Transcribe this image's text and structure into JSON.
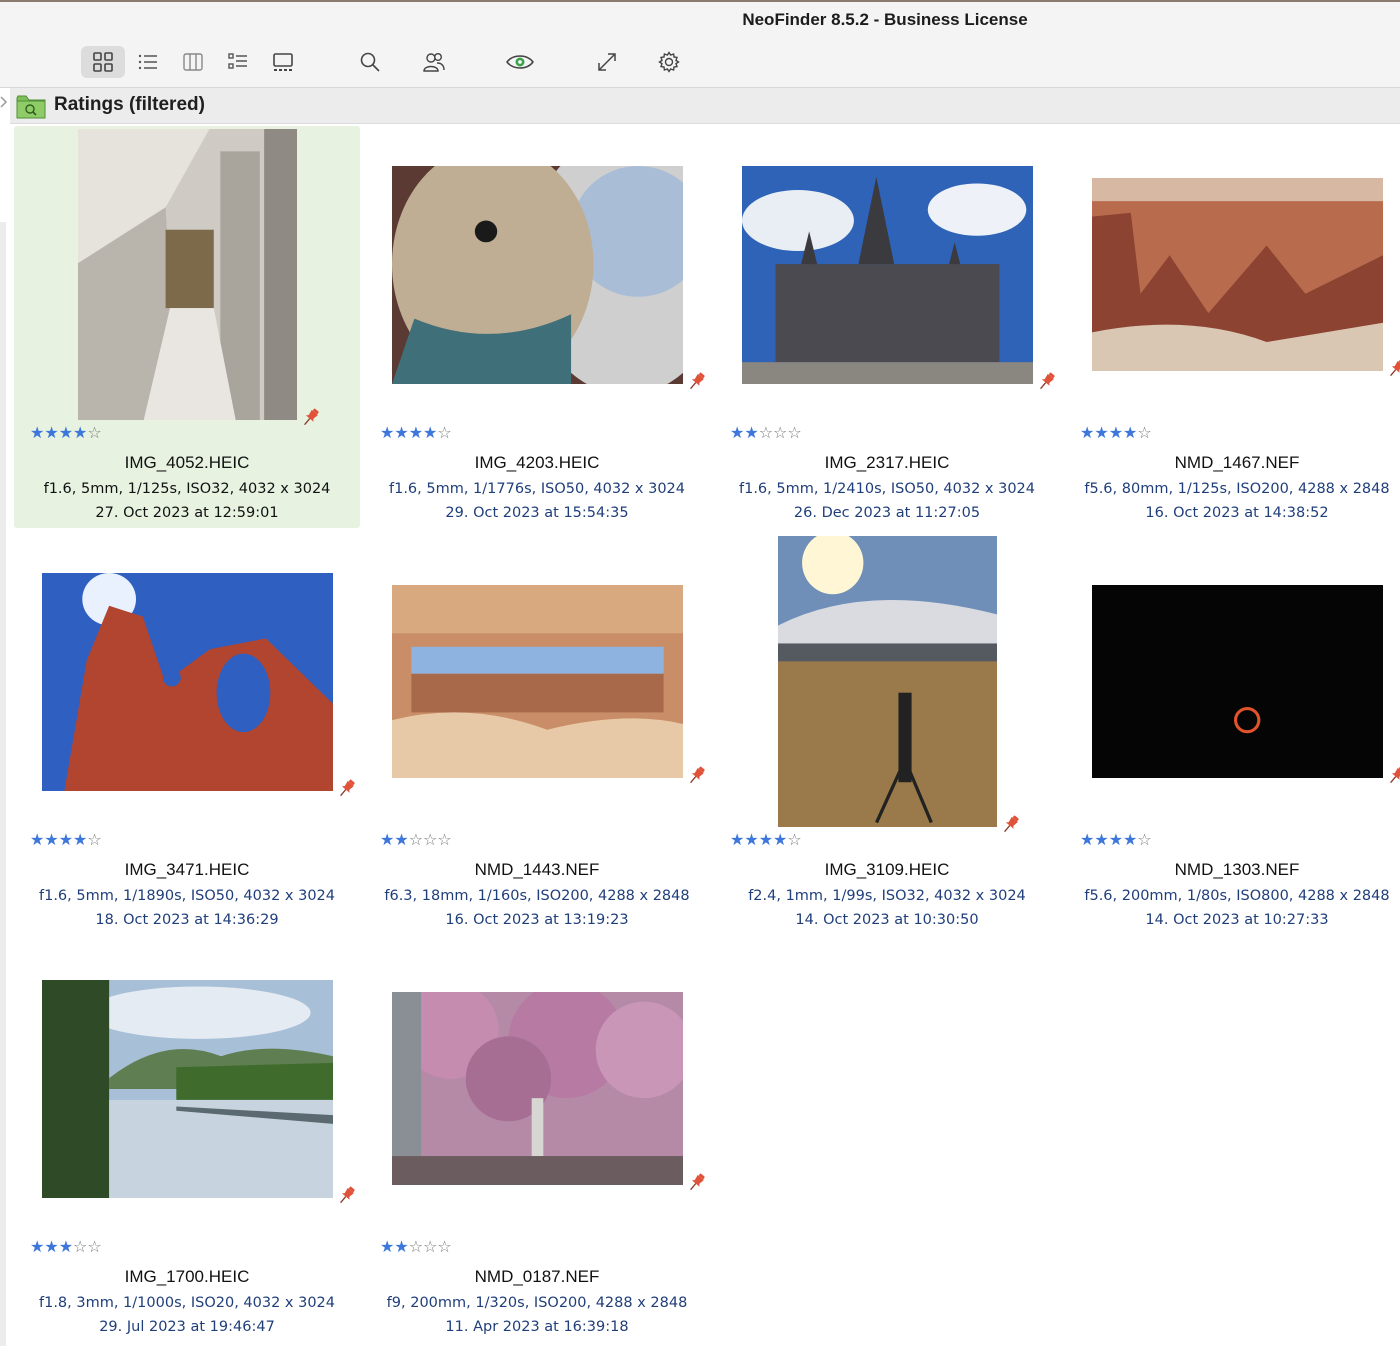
{
  "window": {
    "title": "NeoFinder 8.5.2 - Business License"
  },
  "toolbar": {
    "buttons": [
      {
        "name": "grid-view-icon",
        "active": true
      },
      {
        "name": "list-view-icon"
      },
      {
        "name": "column-view-icon"
      },
      {
        "name": "outline-view-icon"
      },
      {
        "name": "gallery-view-icon"
      },
      {
        "name": "search-icon"
      },
      {
        "name": "people-icon"
      },
      {
        "name": "eye-icon"
      },
      {
        "name": "fullscreen-icon"
      },
      {
        "name": "gear-icon"
      }
    ]
  },
  "path": {
    "label": "Ratings  (filtered)"
  },
  "items": [
    {
      "file": "IMG_4052.HEIC",
      "exif": "f1.6, 5mm, 1/125s, ISO32, 4032 x 3024",
      "date": "27. Oct 2023 at 12:59:01",
      "stars": 4,
      "selected": true,
      "pic": "interior",
      "orient": "portrait"
    },
    {
      "file": "IMG_4203.HEIC",
      "exif": "f1.6, 5mm, 1/1776s, ISO50, 4032 x 3024",
      "date": "29. Oct 2023 at 15:54:35",
      "stars": 4,
      "pic": "plush",
      "orient": "landscape43"
    },
    {
      "file": "IMG_2317.HEIC",
      "exif": "f1.6, 5mm, 1/2410s, ISO50, 4032 x 3024",
      "date": "26. Dec 2023 at 11:27:05",
      "stars": 2,
      "pic": "church",
      "orient": "landscape43"
    },
    {
      "file": "NMD_1467.NEF",
      "exif": "f5.6, 80mm, 1/125s, ISO200, 4288 x 2848",
      "date": "16. Oct 2023 at 14:38:52",
      "stars": 4,
      "pic": "canyon",
      "orient": "landscape32"
    },
    {
      "file": "IMG_3471.HEIC",
      "exif": "f1.6, 5mm, 1/1890s, ISO50, 4032 x 3024",
      "date": "18. Oct 2023 at 14:36:29",
      "stars": 4,
      "pic": "arch",
      "orient": "landscape43"
    },
    {
      "file": "NMD_1443.NEF",
      "exif": "f6.3, 18mm, 1/160s, ISO200, 4288 x 2848",
      "date": "16. Oct 2023 at 13:19:23",
      "stars": 2,
      "pic": "mesa",
      "orient": "landscape32"
    },
    {
      "file": "IMG_3109.HEIC",
      "exif": "f2.4, 1mm, 1/99s, ISO32, 4032 x 3024",
      "date": "14. Oct 2023 at 10:30:50",
      "stars": 4,
      "pic": "field",
      "orient": "portrait"
    },
    {
      "file": "NMD_1303.NEF",
      "exif": "f5.6, 200mm, 1/80s, ISO800, 4288 x 2848",
      "date": "14. Oct 2023 at 10:27:33",
      "stars": 4,
      "pic": "eclipse",
      "orient": "landscape32"
    },
    {
      "file": "IMG_1700.HEIC",
      "exif": "f1.8, 3mm, 1/1000s, ISO20, 4032 x 3024",
      "date": "29. Jul 2023 at 19:46:47",
      "stars": 3,
      "pic": "river",
      "orient": "landscape43"
    },
    {
      "file": "NMD_0187.NEF",
      "exif": "f9, 200mm, 1/320s, ISO200, 4288 x 2848",
      "date": "11. Apr 2023 at 16:39:18",
      "stars": 2,
      "pic": "blossom",
      "orient": "landscape32"
    }
  ],
  "colors": {
    "star_on": "#3d77db",
    "selected_bg": "#e7f2e1",
    "meta_text": "#1f3e7a",
    "pin": "#e0533a"
  }
}
